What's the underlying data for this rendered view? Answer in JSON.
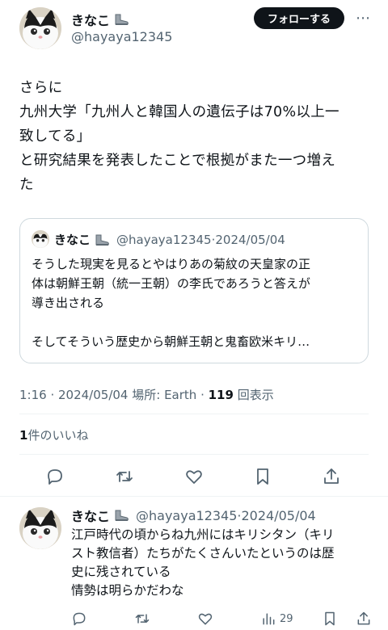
{
  "tweet": {
    "author_name": "きなこ",
    "author_handle": "@hayaya12345",
    "follow_label": "フォローする",
    "text_lines": [
      "さらに",
      "九州大学「九州人と韓国人の遺伝子は70%以上一",
      "致してる」",
      "と研究結果を発表したことで根拠がまた一つ増え",
      "た"
    ],
    "time": "1:16",
    "date": "2024/05/04",
    "location_label": "場所: Earth",
    "views_count": "119",
    "views_label": "回表示",
    "likes_count": "1",
    "likes_label": "件のいいね"
  },
  "quote": {
    "author_name": "きなこ",
    "author_handle": "@hayaya12345",
    "date": "2024/05/04",
    "text_lines": [
      "そうした現実を見るとやはりあの菊紋の天皇家の正",
      "体は朝鮮王朝（統一王朝）の李氏であろうと答えが",
      "導き出される",
      "",
      "そしてそういう歴史から朝鮮王朝と鬼畜欧米キリ…"
    ]
  },
  "reply": {
    "author_name": "きなこ",
    "author_handle": "@hayaya12345",
    "date": "2024/05/04",
    "text_lines": [
      "江戸時代の頃からね九州にはキリシタン（キリ",
      "スト教信者）たちがたくさんいたというのは歴",
      "史に残されている",
      "情勢は明らかだわな"
    ],
    "views_count": "29"
  },
  "icons": {
    "reply": "reply-icon",
    "retweet": "retweet-icon",
    "like": "heart-icon",
    "bookmark": "bookmark-icon",
    "share": "share-icon",
    "views": "views-chart-icon",
    "emoji": "boot-emoji-icon"
  },
  "colors": {
    "text": "#0f1419",
    "secondary": "#536471",
    "border": "#cfd9de",
    "follow_bg": "#0f1419"
  }
}
